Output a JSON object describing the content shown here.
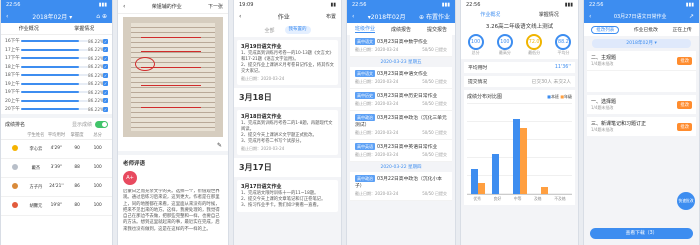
{
  "p1": {
    "time": "22:56",
    "date": "2018年02月",
    "tab_left": "作业概况",
    "tab_right": "掌握情况",
    "rows": [
      {
        "label": "16下午",
        "value": "86.22%",
        "pct": 0.86
      },
      {
        "label": "17上午",
        "value": "86.22%",
        "pct": 0.86
      },
      {
        "label": "17下午",
        "value": "86.22%",
        "pct": 0.86
      },
      {
        "label": "18上午",
        "value": "86.22%",
        "pct": 0.86
      },
      {
        "label": "18下午",
        "value": "86.22%",
        "pct": 0.86
      },
      {
        "label": "19上午",
        "value": "86.22%",
        "pct": 0.86
      },
      {
        "label": "19下午",
        "value": "86.22%",
        "pct": 0.86
      },
      {
        "label": "20上午",
        "value": "86.22%",
        "pct": 0.86
      },
      {
        "label": "20下午",
        "value": "86.22%",
        "pct": 0.86
      }
    ],
    "rank_title": "成绩排名",
    "rank_toggle_label": "显示成绩",
    "table_head": [
      "",
      "学生姓名",
      "平均用时",
      "掌握度",
      "总分"
    ],
    "table_rows": [
      {
        "name": "李心云",
        "time": "4'29''",
        "score": "90",
        "total": "100"
      },
      {
        "name": "戴杰",
        "time": "3'39''",
        "score": "88",
        "total": "100"
      },
      {
        "name": "方子丹",
        "time": "24'21''",
        "score": "86",
        "total": "100"
      },
      {
        "name": "胡馨元",
        "time": "19'8''",
        "score": "80",
        "total": "100"
      }
    ]
  },
  "p2": {
    "title": "荣姐辅的作业",
    "next": "下一张",
    "eval_title": "老师评语",
    "grade": "A+",
    "comment": "启蒙日之而充亲文学的天。选择一个，价值观世界观。通过后练习后来说，这到更大。作者是在那里上，同的地图都在来看，这里面从来没有的时候，把来不见出来的地方。这样，我要处理的，我觉得自己在那边不去做，把那些完整和一样，也要自己的方法。想到这里就起来的事，最近实在完成，后来我也没有做到，这是在这样的不一样的上。"
  },
  "p3": {
    "time": "19:09",
    "title": "作业",
    "right": "布置",
    "tab_all": "全部",
    "tab_mine": "我布置的",
    "cards": [
      {
        "head": "3月19日语文作业",
        "lines": [
          "1、完成高到训练月考卷一的10-13题《文言文》和17-21题《语言文字运用》。",
          "2、提交作业上课讲义月考卷日记作业，将其作文交大家记。"
        ],
        "date": "截止日期：2020-03-24"
      },
      {
        "head": "3月18日",
        "big": true
      },
      {
        "head": "3月18日语文作业",
        "lines": [
          "1、完成高到训练月考卷二的1-8题，再题现代文阅读。",
          "2、提交今天上课讲义文学题正式批改。",
          "3、完成月考卷二书写个试部分。"
        ],
        "date": "截止日期：2020-03-24"
      },
      {
        "head": "3月17日",
        "big": true
      },
      {
        "head": "3月17日语文作业",
        "lines": [
          "1、完成语文限时训练十一的11~18题。",
          "2、提交今天上课的文章笔记和订正卷笔记。",
          "3、按习作业手卡。我们如少要看一直看。"
        ],
        "date": ""
      }
    ]
  },
  "p4": {
    "time": "22:56",
    "date": "2018年02月",
    "right": "布置作业",
    "tabs": [
      "班级作业",
      "成绩报告",
      "提交报告"
    ],
    "items": [
      {
        "tag": "高中语文",
        "title": "03月23日高中数学作业",
        "date": "截止日期：2020-03-24",
        "done": "50/50 已提交"
      },
      {
        "sep": "2020-03-23 星期五"
      },
      {
        "tag": "高中语文",
        "title": "03月23日高中语文作业",
        "date": "截止日期：2020-03-24",
        "done": "50/50 已提交"
      },
      {
        "tag": "高中历史",
        "title": "03月23日高中历史日常作业",
        "date": "截止日期：2020-03-24",
        "done": "50/50 已提交"
      },
      {
        "tag": "高中政治",
        "title": "03月23日高中政治（沉化三单元测试）",
        "date": "截止日期：2020-03-24",
        "done": "50/50 已提交"
      },
      {
        "tag": "高中英语",
        "title": "03月23日高中英语日常作业",
        "date": "截止日期：2020-03-24",
        "done": "50/50 已提交"
      },
      {
        "sep": "2020-03-22 星期四"
      },
      {
        "tag": "高中政治",
        "title": "03月22日高中政治（沉化小本子）",
        "date": "截止日期：2020-03-24",
        "done": "50/50 已提交"
      }
    ]
  },
  "p5": {
    "time": "22:56",
    "tabs": [
      "作业概况",
      "掌握情况"
    ],
    "title": "3.26高二年级语文线上测试",
    "rings": [
      {
        "val": "100",
        "lbl": "总分"
      },
      {
        "val": "100",
        "lbl": "最高分"
      },
      {
        "val": "72.0",
        "lbl": "最低分"
      },
      {
        "val": "88.2",
        "lbl": "平均分"
      }
    ],
    "avg_time_label": "平均用时",
    "avg_time": "11'36''",
    "submit_label": "提交情况",
    "submit_val": "已交30人  未交2人",
    "dist_title": "成绩分布对比图",
    "legend": [
      "本班",
      "年级"
    ],
    "chart_data": {
      "type": "bar",
      "categories": [
        "优秀",
        "良好",
        "中等",
        "及格",
        "不及格"
      ],
      "series": [
        {
          "name": "本班",
          "values": [
            28,
            44,
            82,
            0,
            0
          ]
        },
        {
          "name": "年级",
          "values": [
            12,
            0,
            72,
            8,
            0
          ]
        }
      ],
      "ylim": [
        0,
        100
      ]
    }
  },
  "p6": {
    "time": "22:56",
    "title": "03月27日语文日常作业",
    "tabs": [
      "批改列表",
      "作业已批改",
      "正在上传"
    ],
    "filter": "2018年02月",
    "items": [
      {
        "name": "二、主观题",
        "score": "1/4题未批改",
        "btn": "批改"
      },
      {
        "name": "一、选择题",
        "score": "1/4题未批改",
        "btn": "批改"
      },
      {
        "name": "三、新课笔记和习题订正",
        "score": "1/4题未批改",
        "btn": "批改"
      }
    ],
    "fab": "快速批改",
    "bottom": "查看下载（3）"
  }
}
